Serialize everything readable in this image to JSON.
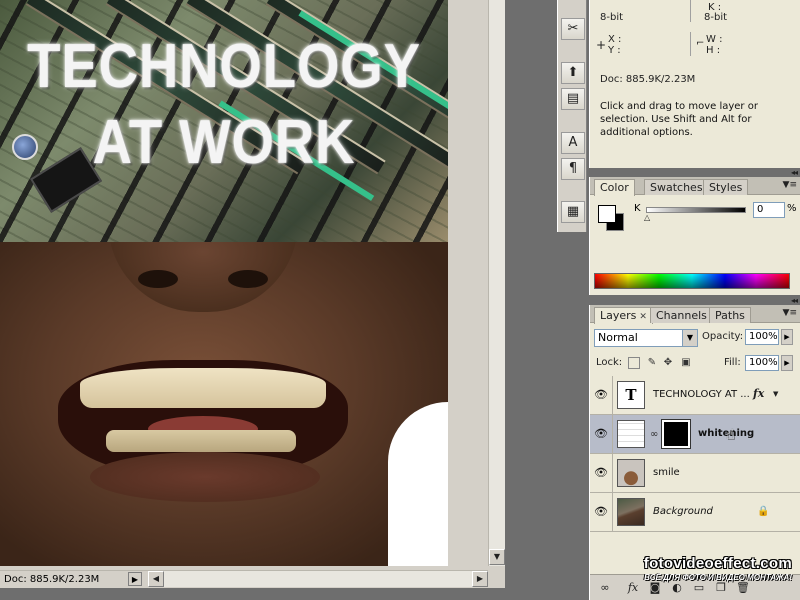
{
  "canvas": {
    "headline_line1": "TECHNOLOGY",
    "headline_line2": "AT WORK"
  },
  "status_bar": {
    "doc_size": "Doc: 885.9K/2.23M"
  },
  "tools": [
    {
      "icon": "scissors-tool-icon",
      "glyph": "✂"
    },
    {
      "icon": "path-select-icon",
      "glyph": "⬆"
    },
    {
      "icon": "pen-tool-icon",
      "glyph": "▤"
    },
    {
      "icon": "character-panel-icon",
      "glyph": "A"
    },
    {
      "icon": "paragraph-panel-icon",
      "glyph": "¶"
    },
    {
      "icon": "notes-icon",
      "glyph": "▦"
    }
  ],
  "info_panel": {
    "k_label": "K :",
    "bit_left": "8-bit",
    "bit_right": "8-bit",
    "x_label": "X :",
    "y_label": "Y :",
    "w_label": "W :",
    "h_label": "H :",
    "doc_size": "Doc: 885.9K/2.23M",
    "hint": "Click and drag to move layer or selection.  Use Shift and Alt for additional options."
  },
  "color_panel": {
    "tabs": [
      "Color",
      "Swatches",
      "Styles"
    ],
    "channel_label": "K",
    "channel_value": "0",
    "unit": "%",
    "foreground": "#ffffff",
    "background": "#000000"
  },
  "layers_panel": {
    "tabs": [
      "Layers",
      "Channels",
      "Paths"
    ],
    "blend_mode": "Normal",
    "opacity_label": "Opacity:",
    "opacity_value": "100%",
    "lock_label": "Lock:",
    "fill_label": "Fill:",
    "fill_value": "100%",
    "layers": [
      {
        "name": "TECHNOLOGY AT ...",
        "type": "text",
        "thumb_glyph": "T",
        "has_fx": true,
        "fx_label": "fx"
      },
      {
        "name": "whitening",
        "type": "adjustment",
        "selected": true
      },
      {
        "name": "smile",
        "type": "pixel"
      },
      {
        "name": "Background",
        "type": "background",
        "locked": true
      }
    ]
  },
  "watermark": {
    "site": "fotovideoeffect.com",
    "tagline": "ВСЁ ДЛЯ ФОТО И ВИДЕО МОНТАЖА!"
  }
}
